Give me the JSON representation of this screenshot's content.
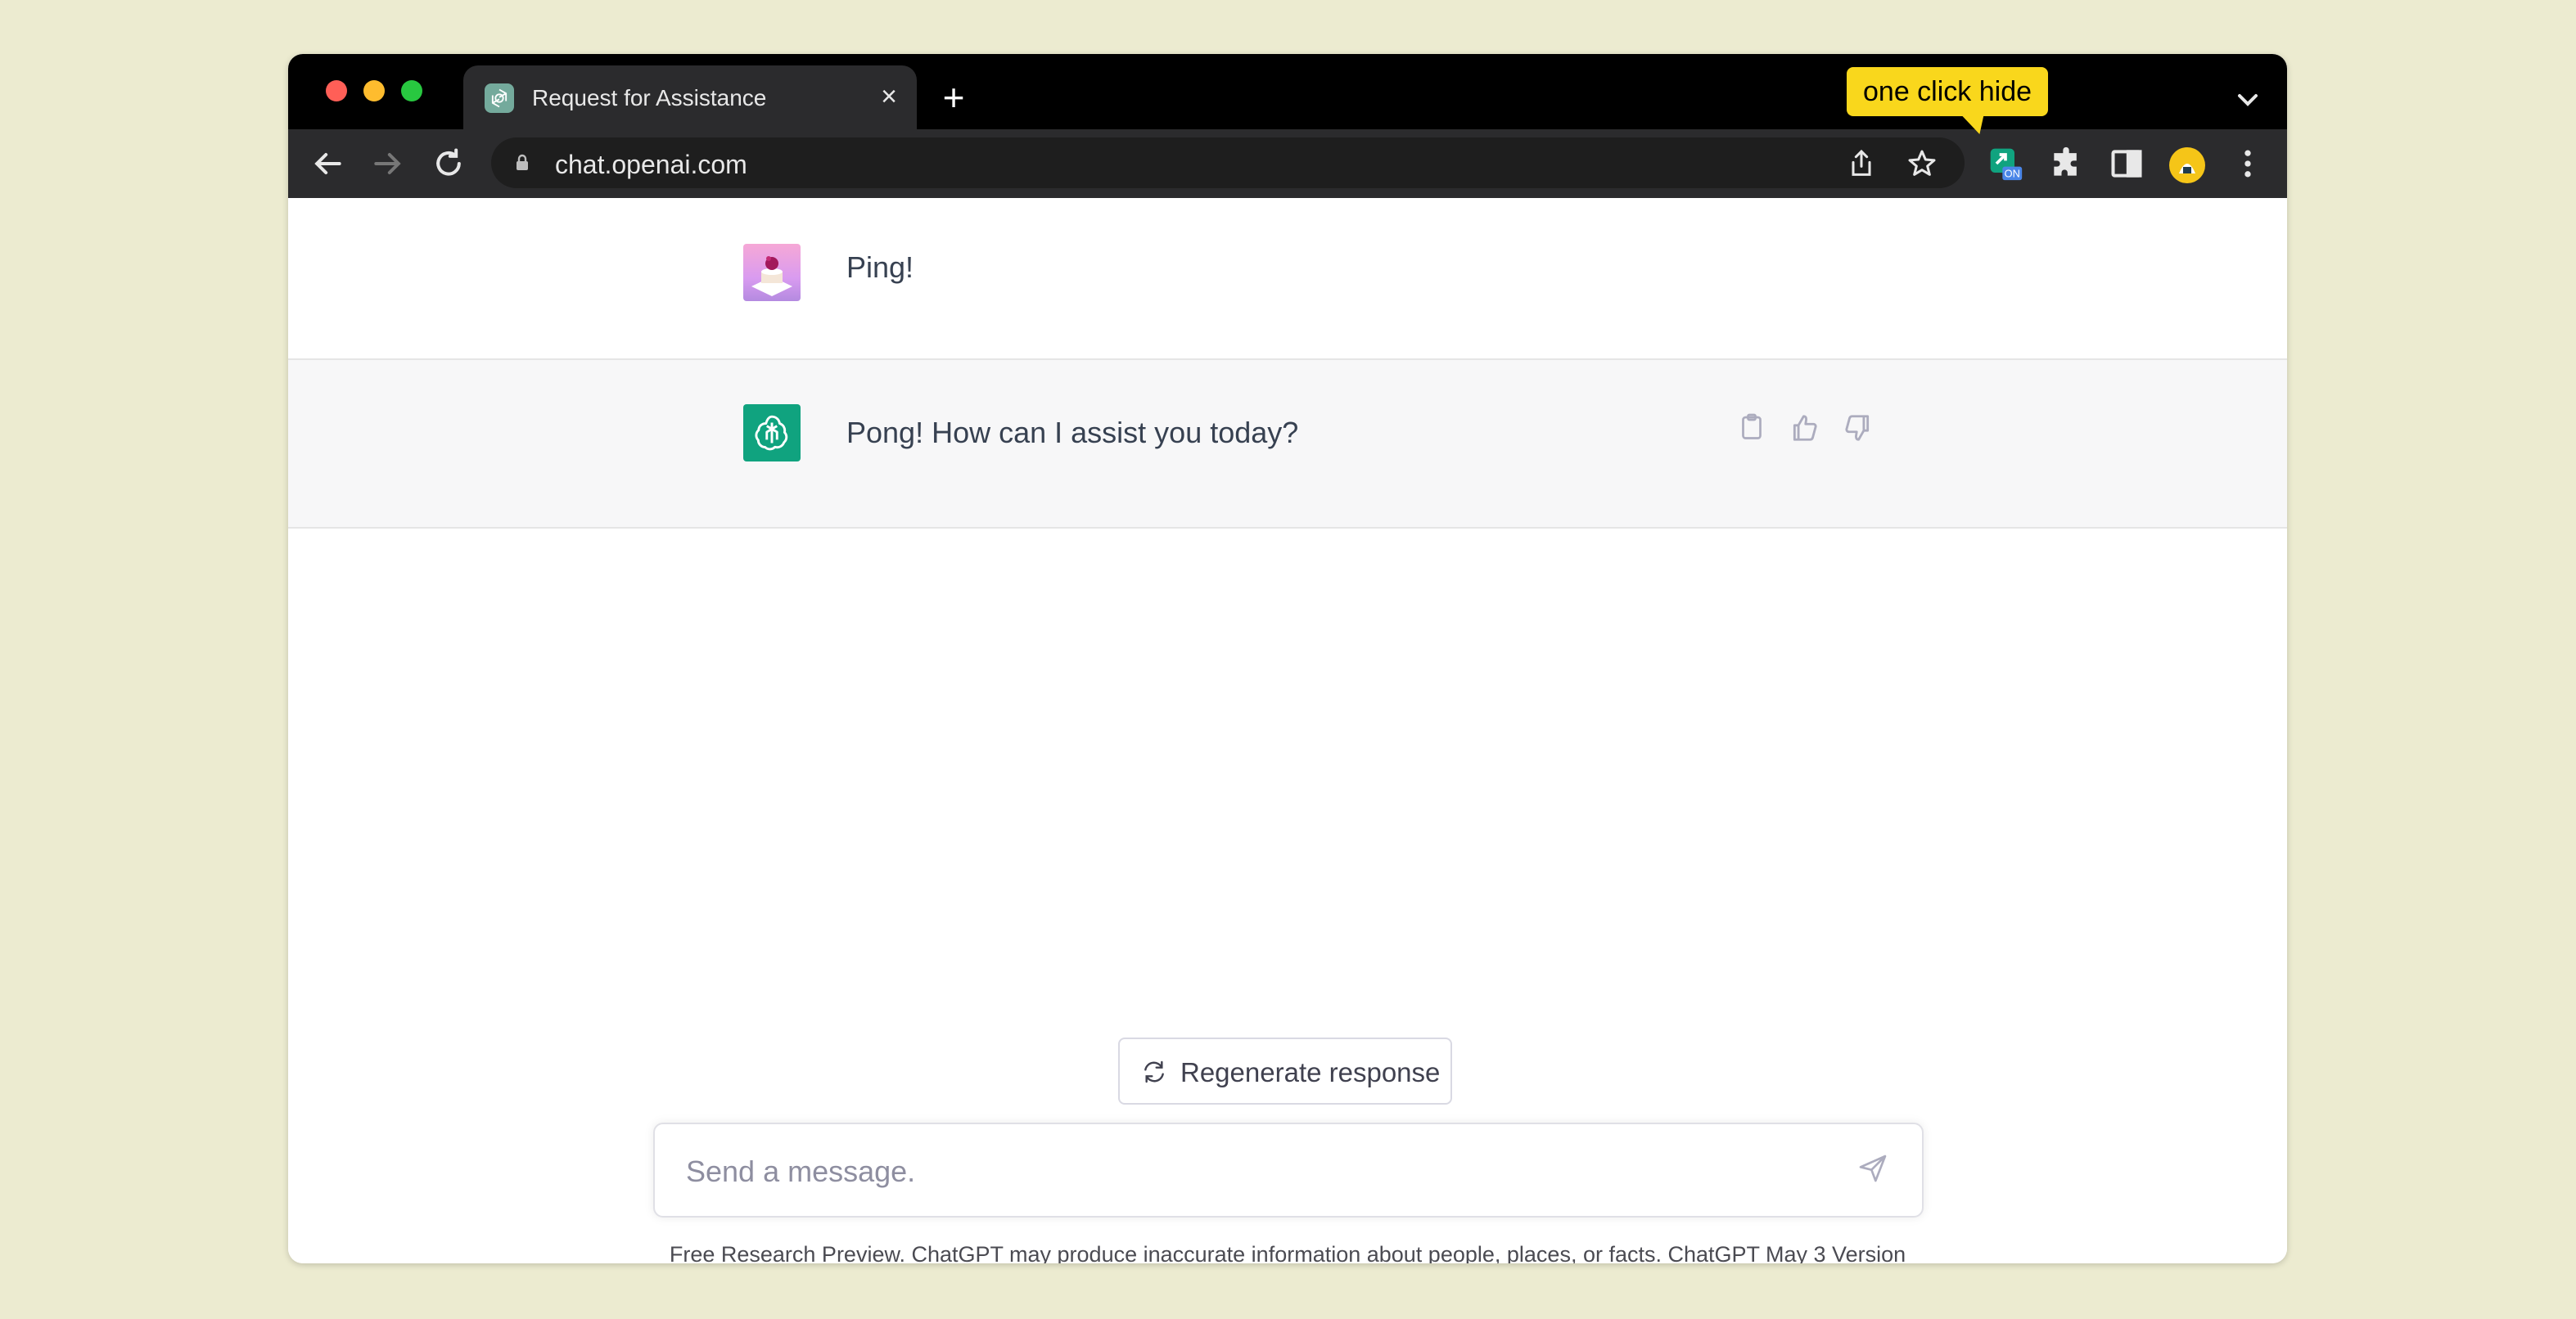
{
  "browser": {
    "tab": {
      "title": "Request for Assistance",
      "close_glyph": "×"
    },
    "new_tab_glyph": "+",
    "url": "chat.openai.com",
    "extension_tooltip": "one click hide",
    "extension_badge": "ON"
  },
  "chat": {
    "messages": [
      {
        "role": "user",
        "text": "Ping!"
      },
      {
        "role": "assistant",
        "text": "Pong! How can I assist you today?"
      }
    ],
    "regenerate_label": "Regenerate response",
    "composer_placeholder": "Send a message.",
    "disclaimer_text": "Free Research Preview. ChatGPT may produce inaccurate information about people, places, or facts. ",
    "disclaimer_link": "ChatGPT May 3 Version"
  },
  "colors": {
    "page_background": "#ecebd0",
    "chatgpt_green": "#10a37f",
    "tooltip_yellow": "#f9d71c",
    "assistant_row_bg": "#f7f7f8"
  }
}
